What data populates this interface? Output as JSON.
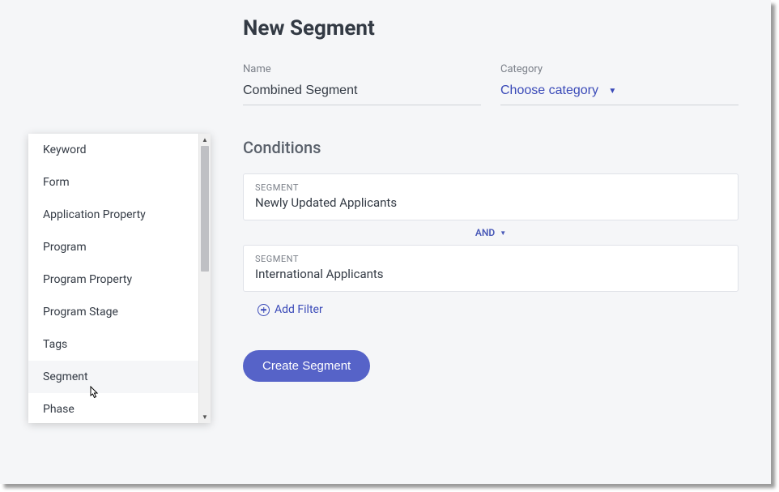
{
  "header": {
    "title": "New Segment"
  },
  "form": {
    "name_label": "Name",
    "name_value": "Combined Segment",
    "category_label": "Category",
    "category_placeholder": "Choose category"
  },
  "conditions": {
    "section_title": "Conditions",
    "items": [
      {
        "type_label": "SEGMENT",
        "value": "Newly Updated Applicants"
      },
      {
        "type_label": "SEGMENT",
        "value": "International Applicants"
      }
    ],
    "connector": "AND",
    "add_filter_label": "Add Filter"
  },
  "actions": {
    "create_label": "Create Segment"
  },
  "dropdown": {
    "items": [
      "Keyword",
      "Form",
      "Application Property",
      "Program",
      "Program Property",
      "Program Stage",
      "Tags",
      "Segment",
      "Phase"
    ],
    "hovered_index": 7
  }
}
